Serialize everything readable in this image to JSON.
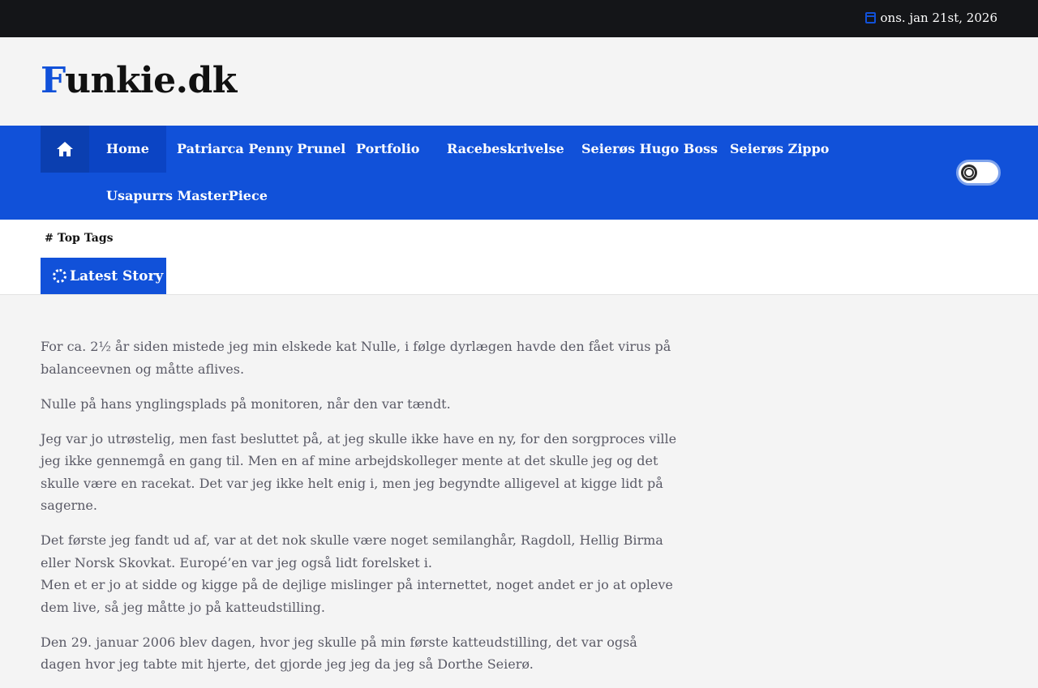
{
  "topbar": {
    "date": "ons. jan 21st, 2026",
    "date_icon": "calendar-icon"
  },
  "header": {
    "logo_first": "F",
    "logo_rest": "unkie.dk"
  },
  "nav": {
    "home_icon": "home-icon",
    "items": [
      "Home",
      "Patriarca Penny Prunel",
      "Portfolio",
      "Racebeskrivelse",
      "Seierøs Hugo Boss",
      "Seierøs Zippo",
      "Usapurrs MasterPiece"
    ],
    "accent_color": "#1151d9"
  },
  "tags": {
    "top_tags_label": "Top Tags",
    "latest_story_label": "Latest Story"
  },
  "article": {
    "paragraphs": [
      "For ca. 2½ år siden mistede jeg min elskede kat Nulle, i følge dyrlægen havde den fået virus på balanceevnen og måtte aflives.",
      "Nulle på hans ynglingsplads på monitoren, når den var tændt.",
      "Jeg var jo utrøstelig, men fast besluttet på, at jeg skulle ikke have en ny, for den sorgproces ville jeg ikke gennemgå en gang til. Men en af mine arbejdskolleger mente at det skulle jeg og det skulle være en racekat. Det var jeg ikke helt enig i, men jeg begyndte alligevel at kigge lidt på sagerne.",
      "Det første jeg fandt ud af, var at det nok skulle være noget semilanghår, Ragdoll, Hellig Birma eller Norsk Skovkat. Europé’en var jeg også lidt forelsket i.",
      "Men et er jo at sidde og kigge på de dejlige mislinger på internettet, noget andet er jo at opleve dem live, så jeg måtte jo på katteudstilling.",
      "Den 29. januar 2006 blev dagen, hvor jeg skulle på min første katteudstilling, det var også dagen hvor jeg tabte mit hjerte, det gjorde jeg jeg da jeg så Dorthe Seierø."
    ]
  }
}
